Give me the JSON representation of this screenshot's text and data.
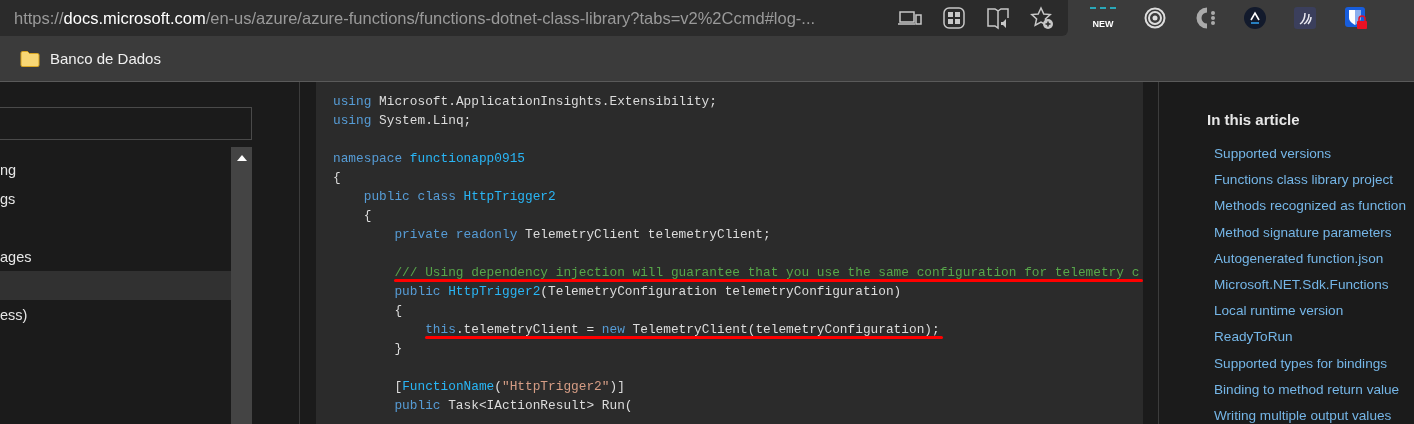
{
  "toolbar": {
    "url": {
      "scheme": "https://",
      "host": "docs.microsoft.com",
      "path": "/en-us/azure/azure-functions/functions-dotnet-class-library?tabs=v2%2Ccmd#log-..."
    },
    "extensions": [
      {
        "kind": "new",
        "label": "NEW"
      },
      {
        "kind": "rings"
      },
      {
        "kind": "c-dots"
      },
      {
        "kind": "caret"
      },
      {
        "kind": "swoosh"
      },
      {
        "kind": "shield"
      }
    ]
  },
  "bookmarks": [
    {
      "label": "Banco de Dados"
    }
  ],
  "sidebar": {
    "items": [
      {
        "kind": "link",
        "label": "ng",
        "selected": false
      },
      {
        "kind": "link",
        "label": "gs",
        "selected": false
      },
      {
        "kind": "blank"
      },
      {
        "kind": "link",
        "label": "ages",
        "selected": false
      },
      {
        "kind": "blank",
        "selected": true
      },
      {
        "kind": "link",
        "label": "ess)",
        "selected": false
      }
    ]
  },
  "code": {
    "lines": [
      {
        "kind": "code",
        "tokens": [
          {
            "text": "using",
            "kind": "keyword"
          },
          {
            "text": " Microsoft.ApplicationInsights.Extensibility;",
            "kind": "plain"
          }
        ]
      },
      {
        "kind": "code",
        "tokens": [
          {
            "text": "using",
            "kind": "keyword"
          },
          {
            "text": " System.Linq;",
            "kind": "plain"
          }
        ]
      },
      {
        "kind": "blank"
      },
      {
        "kind": "code",
        "tokens": [
          {
            "text": "namespace",
            "kind": "keyword"
          },
          {
            "text": " functionapp0915",
            "kind": "name"
          }
        ]
      },
      {
        "kind": "code",
        "tokens": [
          {
            "text": "{",
            "kind": "plain"
          }
        ]
      },
      {
        "kind": "code",
        "tokens": [
          {
            "text": "    public class",
            "kind": "keyword"
          },
          {
            "text": " HttpTrigger2",
            "kind": "name"
          }
        ]
      },
      {
        "kind": "code",
        "tokens": [
          {
            "text": "    {",
            "kind": "plain"
          }
        ]
      },
      {
        "kind": "code",
        "tokens": [
          {
            "text": "        private readonly",
            "kind": "keyword"
          },
          {
            "text": " TelemetryClient telemetryClient;",
            "kind": "plain"
          }
        ]
      },
      {
        "kind": "blank"
      },
      {
        "kind": "code",
        "underlined": true,
        "tokens": [
          {
            "text": "        /// Using dependency injection will guarantee that you use the same configuration for telemetry c",
            "kind": "comment"
          }
        ]
      },
      {
        "kind": "code",
        "tokens": [
          {
            "text": "        public",
            "kind": "keyword"
          },
          {
            "text": " HttpTrigger2",
            "kind": "name"
          },
          {
            "text": "(TelemetryConfiguration telemetryConfiguration)",
            "kind": "plain"
          }
        ]
      },
      {
        "kind": "code",
        "tokens": [
          {
            "text": "        {",
            "kind": "plain"
          }
        ]
      },
      {
        "kind": "code",
        "underlined": true,
        "tokens": [
          {
            "text": "            this",
            "kind": "keyword"
          },
          {
            "text": ".telemetryClient = ",
            "kind": "plain"
          },
          {
            "text": "new",
            "kind": "keyword"
          },
          {
            "text": " TelemetryClient(telemetryConfiguration);",
            "kind": "plain"
          }
        ]
      },
      {
        "kind": "code",
        "tokens": [
          {
            "text": "        }",
            "kind": "plain"
          }
        ]
      },
      {
        "kind": "blank"
      },
      {
        "kind": "code",
        "tokens": [
          {
            "text": "        [",
            "kind": "plain"
          },
          {
            "text": "FunctionName",
            "kind": "name"
          },
          {
            "text": "(",
            "kind": "plain"
          },
          {
            "text": "\"HttpTrigger2\"",
            "kind": "string"
          },
          {
            "text": ")]",
            "kind": "plain"
          }
        ]
      },
      {
        "kind": "code",
        "tokens": [
          {
            "text": "        public",
            "kind": "keyword"
          },
          {
            "text": " Task<IActionResult> Run(",
            "kind": "plain"
          }
        ]
      }
    ]
  },
  "toc": {
    "title": "In this article",
    "items": [
      {
        "label": "Supported versions"
      },
      {
        "label": "Functions class library project"
      },
      {
        "label": "Methods recognized as function"
      },
      {
        "label": "Method signature parameters"
      },
      {
        "label": "Autogenerated function.json"
      },
      {
        "label": "Microsoft.NET.Sdk.Functions"
      },
      {
        "label": "Local runtime version"
      },
      {
        "label": "ReadyToRun"
      },
      {
        "label": "Supported types for bindings"
      },
      {
        "label": "Binding to method return value"
      },
      {
        "label": "Writing multiple output values"
      }
    ]
  }
}
